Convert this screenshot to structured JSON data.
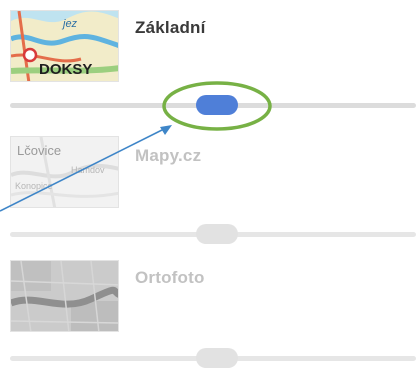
{
  "layers": [
    {
      "label": "Základní",
      "thumb_text_top": "jez",
      "thumb_text_main": "DOKSY",
      "active": true,
      "opacity_percent": 52
    },
    {
      "label": "Mapy.cz",
      "thumb_text_top": "Lčovice",
      "thumb_text_mid": "Hamdov",
      "thumb_text_low": "Konopice",
      "active": false,
      "opacity_percent": 52
    },
    {
      "label": "Ortofoto",
      "active": false,
      "opacity_percent": 52
    }
  ],
  "colors": {
    "active_label": "#3a3a3a",
    "inactive_label": "#c2c2c2",
    "active_knob": "#4f7fd8",
    "inactive_knob": "#e2e2e2",
    "highlight_ellipse": "#77b145",
    "arrow": "#3f86c8"
  }
}
